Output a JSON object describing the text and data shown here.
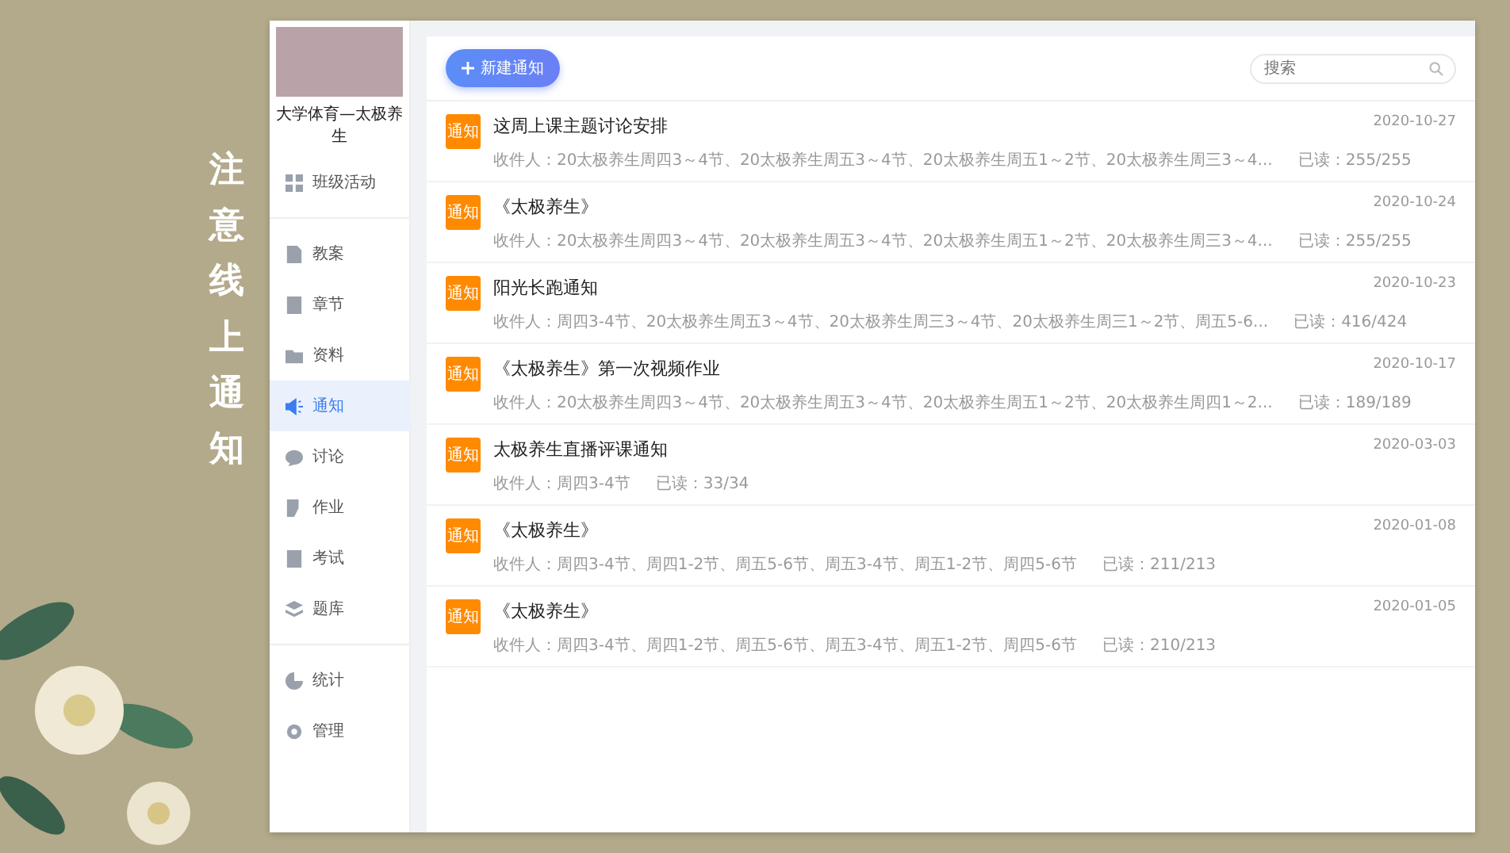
{
  "slide_title": "注意线上通知",
  "sidebar": {
    "course_title": "大学体育—太极养生",
    "sections": [
      {
        "items": [
          {
            "label": "班级活动",
            "selected": false
          }
        ]
      },
      {
        "items": [
          {
            "label": "教案",
            "selected": false
          },
          {
            "label": "章节",
            "selected": false
          },
          {
            "label": "资料",
            "selected": false
          },
          {
            "label": "通知",
            "selected": true
          },
          {
            "label": "讨论",
            "selected": false
          },
          {
            "label": "作业",
            "selected": false
          },
          {
            "label": "考试",
            "selected": false
          },
          {
            "label": "题库",
            "selected": false
          }
        ]
      },
      {
        "items": [
          {
            "label": "统计",
            "selected": false
          },
          {
            "label": "管理",
            "selected": false
          }
        ]
      }
    ]
  },
  "toolbar": {
    "new_button": "新建通知",
    "search": {
      "placeholder": "搜索"
    }
  },
  "notices": [
    {
      "badge": "通知",
      "title": "这周上课主题讨论安排",
      "date": "2020-10-27",
      "recipients": "收件人：20太极养生周四3～4节、20太极养生周五3～4节、20太极养生周五1～2节、20太极养生周三3～4...",
      "read": "已读：255/255"
    },
    {
      "badge": "通知",
      "title": "《太极养生》",
      "date": "2020-10-24",
      "recipients": "收件人：20太极养生周四3～4节、20太极养生周五3～4节、20太极养生周五1～2节、20太极养生周三3～4...",
      "read": "已读：255/255"
    },
    {
      "badge": "通知",
      "title": "阳光长跑通知",
      "date": "2020-10-23",
      "recipients": "收件人：周四3-4节、20太极养生周五3～4节、20太极养生周三3～4节、20太极养生周三1～2节、周五5-6...",
      "read": "已读：416/424"
    },
    {
      "badge": "通知",
      "title": "《太极养生》第一次视频作业",
      "date": "2020-10-17",
      "recipients": "收件人：20太极养生周四3～4节、20太极养生周五3～4节、20太极养生周五1～2节、20太极养生周四1～2...",
      "read": "已读：189/189"
    },
    {
      "badge": "通知",
      "title": "太极养生直播评课通知",
      "date": "2020-03-03",
      "recipients": "收件人：周四3-4节",
      "read": "已读：33/34"
    },
    {
      "badge": "通知",
      "title": "《太极养生》",
      "date": "2020-01-08",
      "recipients": "收件人：周四3-4节、周四1-2节、周五5-6节、周五3-4节、周五1-2节、周四5-6节",
      "read": "已读：211/213"
    },
    {
      "badge": "通知",
      "title": "《太极养生》",
      "date": "2020-01-05",
      "recipients": "收件人：周四3-4节、周四1-2节、周五5-6节、周五3-4节、周五1-2节、周四5-6节",
      "read": "已读：210/213"
    }
  ]
}
